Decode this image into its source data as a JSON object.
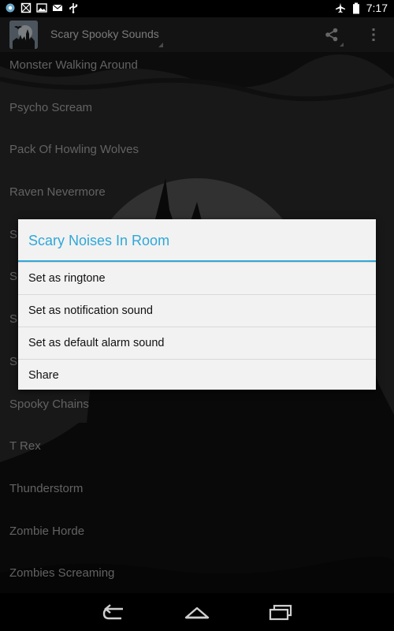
{
  "status_bar": {
    "icons": [
      "app-notification-icon",
      "crossed-box-icon",
      "image-icon",
      "mail-icon",
      "usb-icon"
    ],
    "right_icons": [
      "airplane-mode-icon",
      "battery-icon"
    ],
    "time": "7:17"
  },
  "action_bar": {
    "title": "Scary Spooky Sounds",
    "icons": [
      "app-logo-icon",
      "share-icon",
      "overflow-menu-icon"
    ]
  },
  "sound_list": [
    "Monster Walking Around",
    "Psycho Scream",
    "Pack Of Howling Wolves",
    "Raven Nevermore",
    "S",
    "S",
    "S",
    "S",
    "Spooky Chains",
    "T Rex",
    "Thunderstorm",
    "Zombie Horde",
    "Zombies Screaming"
  ],
  "dialog": {
    "title": "Scary Noises In Room",
    "options": [
      "Set as ringtone",
      "Set as notification sound",
      "Set as default alarm sound",
      "Share"
    ]
  },
  "nav_bar": {
    "icons": [
      "back-icon",
      "home-icon",
      "recent-apps-icon"
    ]
  },
  "colors": {
    "accent": "#2fa7d8",
    "dialog_background": "#f2f2f2",
    "action_bar": "#242424",
    "list_text": "#b3b3b3"
  }
}
